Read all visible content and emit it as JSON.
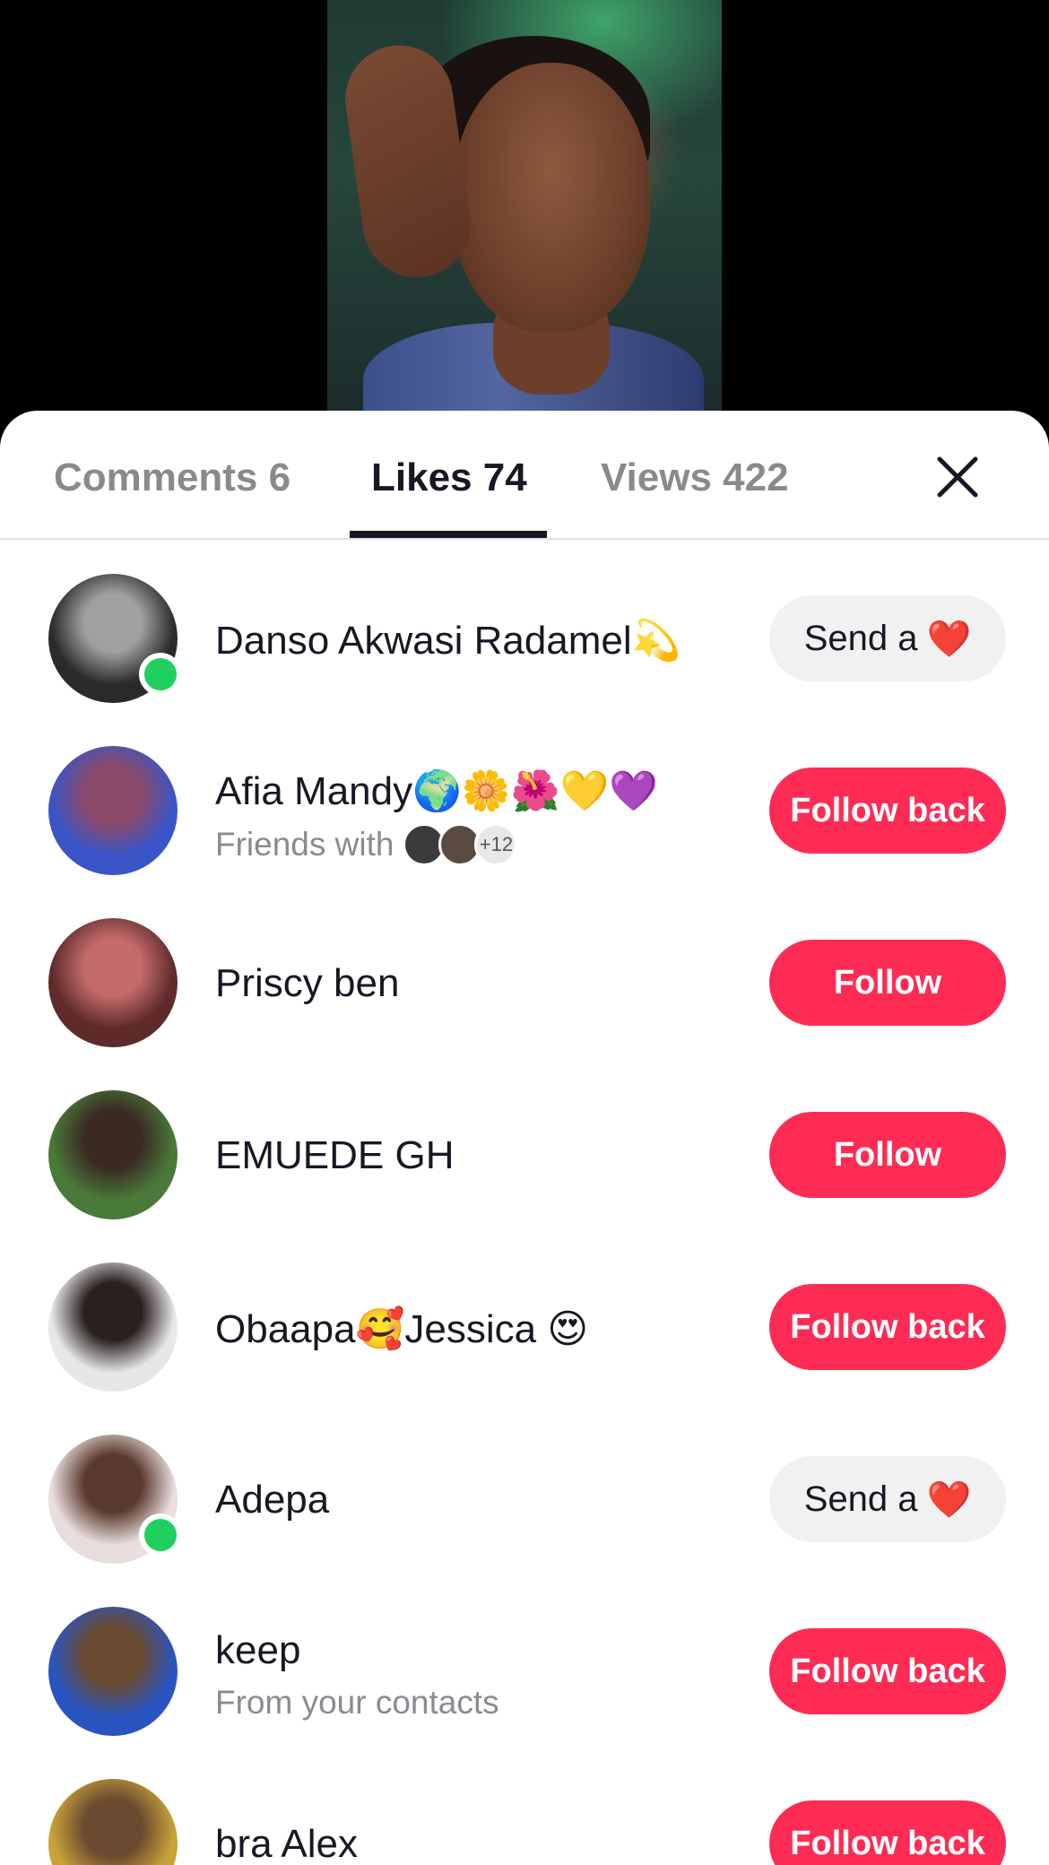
{
  "tabs": [
    {
      "label": "Comments 6"
    },
    {
      "label": "Likes 74"
    },
    {
      "label": "Views 422"
    }
  ],
  "close_icon": "close-icon",
  "users": [
    {
      "name": "Danso Akwasi Radamel💫",
      "sub": "",
      "button": "Send a",
      "button_style": "grey",
      "heart": "❤️",
      "online": true,
      "avatar_colors": [
        "#2b2b2b",
        "#a0a0a0"
      ]
    },
    {
      "name": "Afia Mandy🌍🌼🌺💛💜",
      "sub": "Friends with",
      "friends_count": "+12",
      "button": "Follow back",
      "button_style": "red",
      "online": false,
      "avatar_colors": [
        "#3a55c8",
        "#8a4a6a"
      ]
    },
    {
      "name": "Priscy ben",
      "sub": "",
      "button": "Follow",
      "button_style": "red",
      "online": false,
      "avatar_colors": [
        "#5e2a2a",
        "#c36b6b"
      ]
    },
    {
      "name": "EMUEDE GH",
      "sub": "",
      "button": "Follow",
      "button_style": "red",
      "online": false,
      "avatar_colors": [
        "#4a7a3a",
        "#3a2a22"
      ]
    },
    {
      "name": "Obaapa🥰Jessica 😍",
      "sub": "",
      "button": "Follow back",
      "button_style": "red",
      "online": false,
      "avatar_colors": [
        "#e7e7e7",
        "#2a2020"
      ]
    },
    {
      "name": "Adepa",
      "sub": "",
      "button": "Send a",
      "button_style": "grey",
      "heart": "❤️",
      "online": true,
      "avatar_colors": [
        "#e9dede",
        "#5a3a2e"
      ]
    },
    {
      "name": "keep",
      "sub": "From your contacts",
      "button": "Follow back",
      "button_style": "red",
      "online": false,
      "avatar_colors": [
        "#2a55c0",
        "#6a4a30"
      ]
    },
    {
      "name": "bra Alex",
      "sub": "",
      "button": "Follow back",
      "button_style": "red",
      "online": false,
      "avatar_colors": [
        "#c9a23a",
        "#6a4a30"
      ]
    }
  ]
}
